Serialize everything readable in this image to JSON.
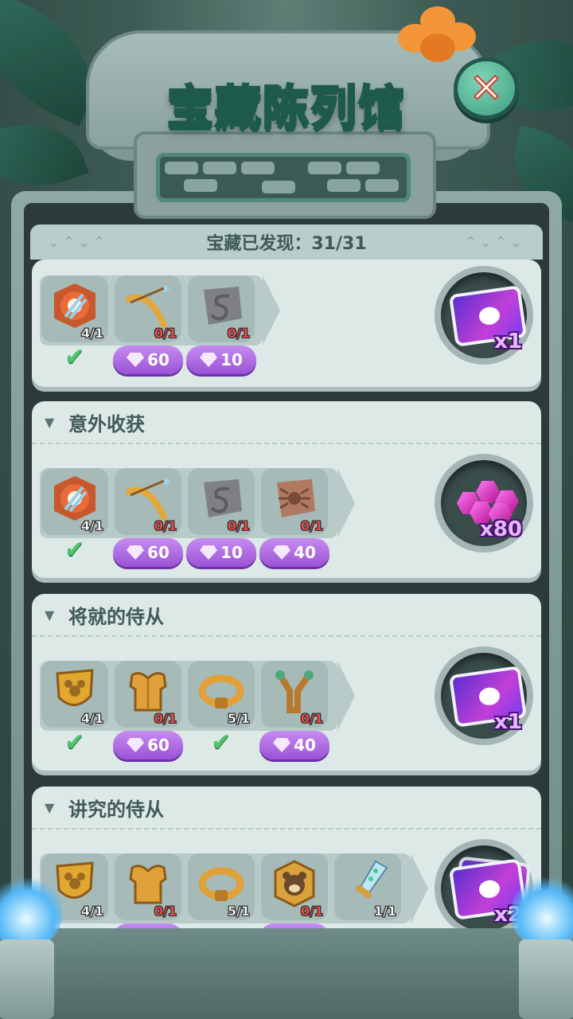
{
  "header": {
    "title": "宝藏陈列馆",
    "close_icon": "close-x-icon"
  },
  "progress": {
    "label": "宝藏已发现：31/31"
  },
  "collections": [
    {
      "title": "",
      "items": [
        {
          "icon": "target-arrows-icon",
          "count": "4/1",
          "owned": true
        },
        {
          "icon": "bow-arrow-icon",
          "count": "0/1",
          "cost": "60"
        },
        {
          "icon": "snake-stone-icon",
          "count": "0/1",
          "cost": "10"
        }
      ],
      "reward": {
        "icon": "mickey-ticket-icon",
        "amount": "x1"
      }
    },
    {
      "title": "意外收获",
      "items": [
        {
          "icon": "target-arrows-icon",
          "count": "4/1",
          "owned": true
        },
        {
          "icon": "bow-arrow-icon",
          "count": "0/1",
          "cost": "60"
        },
        {
          "icon": "snake-stone-icon",
          "count": "0/1",
          "cost": "10"
        },
        {
          "icon": "spider-stone-icon",
          "count": "0/1",
          "cost": "40"
        }
      ],
      "reward": {
        "icon": "purple-gems-icon",
        "amount": "x80"
      }
    },
    {
      "title": "将就的侍从",
      "items": [
        {
          "icon": "mickey-shield-icon",
          "count": "4/1",
          "owned": true
        },
        {
          "icon": "gold-armor-icon",
          "count": "0/1",
          "cost": "60"
        },
        {
          "icon": "gold-belt-icon",
          "count": "5/1",
          "owned": true
        },
        {
          "icon": "slingshot-icon",
          "count": "0/1",
          "cost": "40"
        }
      ],
      "reward": {
        "icon": "mickey-ticket-icon",
        "amount": "x1"
      }
    },
    {
      "title": "讲究的侍从",
      "items": [
        {
          "icon": "mickey-shield-icon",
          "count": "4/1"
        },
        {
          "icon": "gold-armor-icon",
          "count": "0/1"
        },
        {
          "icon": "gold-belt-icon",
          "count": "5/1"
        },
        {
          "icon": "bear-badge-icon",
          "count": "0/1"
        },
        {
          "icon": "crystal-dagger-icon",
          "count": "1/1"
        }
      ],
      "reward": {
        "icon": "mickey-ticket-stack-icon",
        "amount": "x2"
      }
    }
  ]
}
